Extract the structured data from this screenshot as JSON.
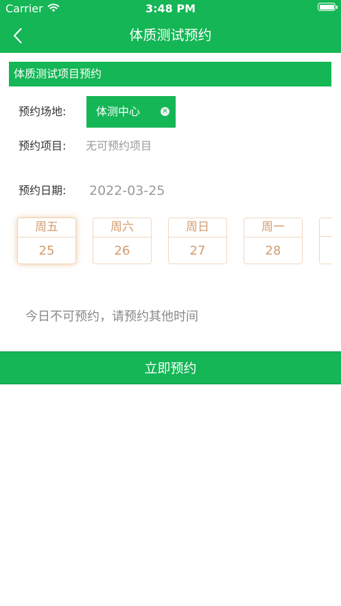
{
  "status_bar": {
    "carrier": "Carrier",
    "time": "3:48 PM"
  },
  "nav": {
    "title": "体质测试预约",
    "back_icon": "chevron-left-icon"
  },
  "section": {
    "header": "体质测试项目预约"
  },
  "form": {
    "venue_label": "预约场地:",
    "venue_value": "体测中心",
    "project_label": "预约项目:",
    "project_value": "无可预约项目",
    "date_label": "预约日期:",
    "date_value": "2022-03-25"
  },
  "dates": [
    {
      "week": "周五",
      "day": "25",
      "selected": true
    },
    {
      "week": "周六",
      "day": "26",
      "selected": false
    },
    {
      "week": "周日",
      "day": "27",
      "selected": false
    },
    {
      "week": "周一",
      "day": "28",
      "selected": false
    }
  ],
  "notice": "今日不可预约，请预约其他时间",
  "submit_label": "立即预约",
  "colors": {
    "primary": "#14b655",
    "date_accent": "#d29b6c",
    "date_border": "#efd7bf"
  }
}
